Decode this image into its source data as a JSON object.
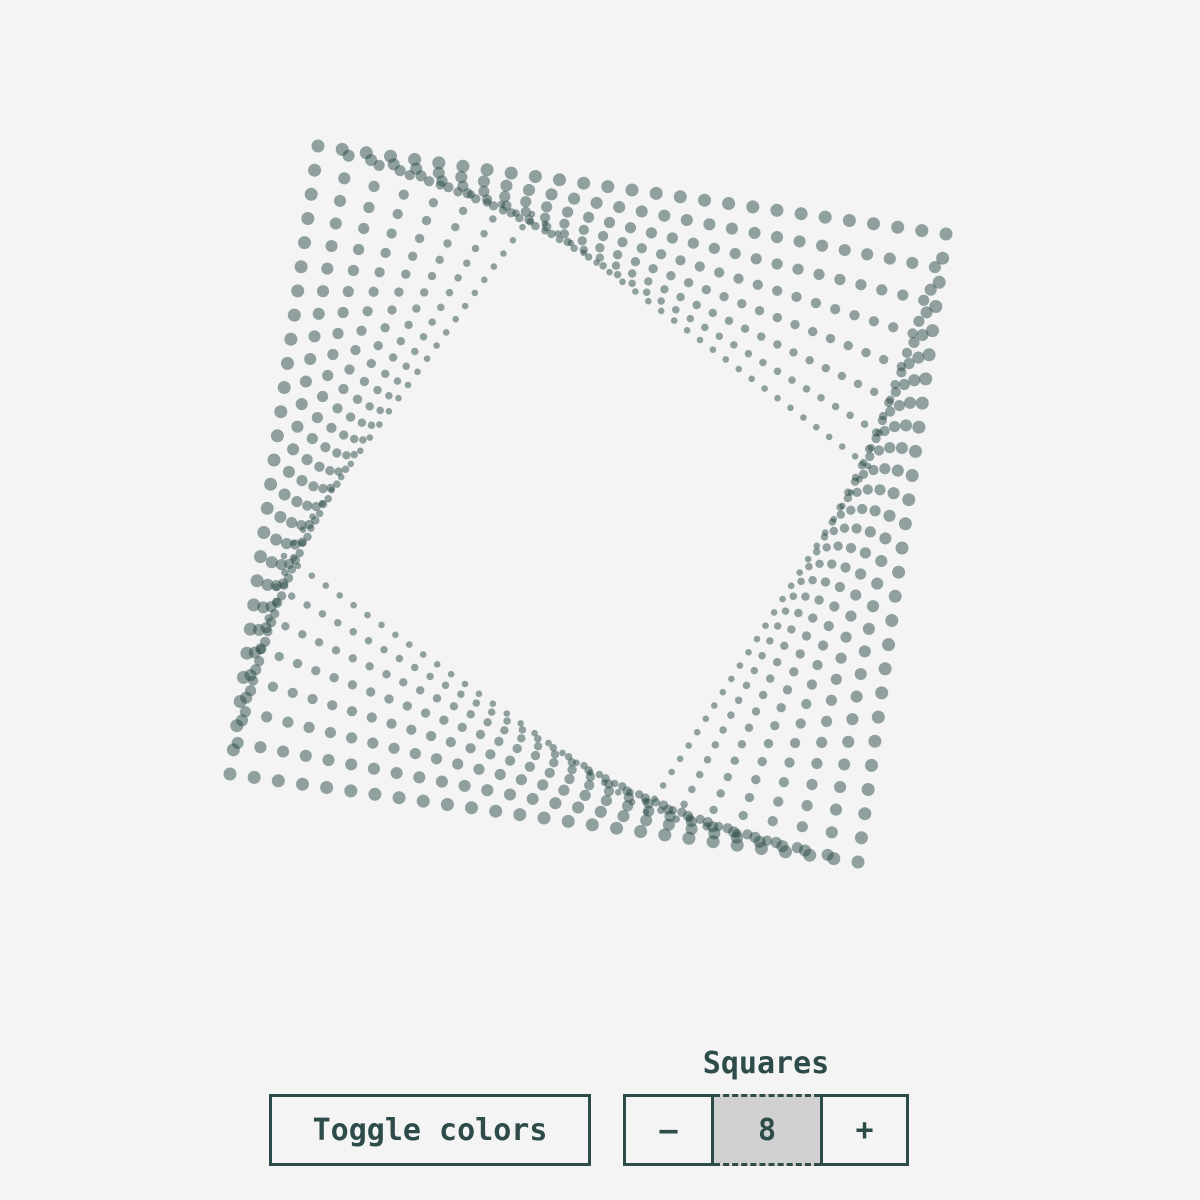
{
  "controls": {
    "toggle_label": "Toggle colors",
    "squares_label": "Squares",
    "minus_label": "–",
    "plus_label": "+",
    "squares_value": "8"
  },
  "art": {
    "dot_color": "#2c4b49",
    "background": "#f4f4f4"
  }
}
